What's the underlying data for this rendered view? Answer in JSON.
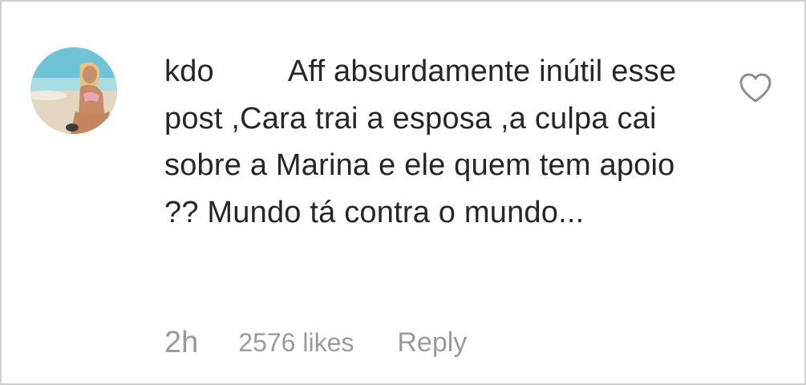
{
  "comment": {
    "username": "kdo",
    "text": "Aff absurdamente inútil esse post ,Cara trai a esposa ,a culpa cai sobre a Marina e ele quem tem apoio ?? Mundo tá contra o mundo...",
    "time": "2h",
    "likes": "2576 likes",
    "reply_label": "Reply",
    "liked": false
  },
  "icons": {
    "like": "heart-outline-icon",
    "avatar": "profile-photo"
  },
  "colors": {
    "text": "#262626",
    "muted": "#9a9a9a",
    "border": "#cfcfcf"
  }
}
